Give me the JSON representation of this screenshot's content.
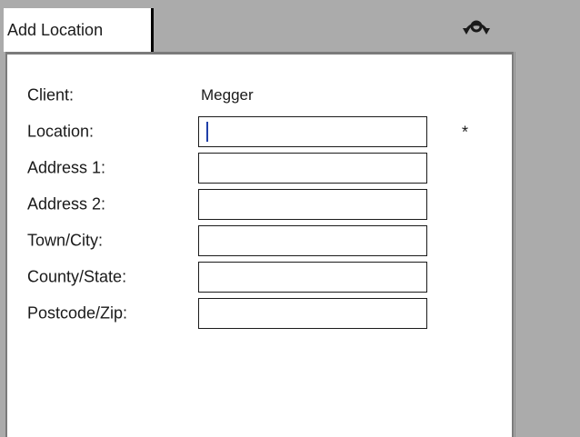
{
  "tab": {
    "label": "Add Location"
  },
  "icons": {
    "rotate": "rotate-icon"
  },
  "form": {
    "client": {
      "label": "Client:",
      "value": "Megger"
    },
    "fields": [
      {
        "label": "Location:",
        "value": "",
        "required_mark": "*"
      },
      {
        "label": "Address 1:",
        "value": ""
      },
      {
        "label": "Address 2:",
        "value": ""
      },
      {
        "label": "Town/City:",
        "value": ""
      },
      {
        "label": "County/State:",
        "value": ""
      },
      {
        "label": "Postcode/Zip:",
        "value": ""
      }
    ]
  },
  "colors": {
    "background": "#ababab",
    "panel": "#ffffff",
    "caret": "#1f3fa8"
  }
}
